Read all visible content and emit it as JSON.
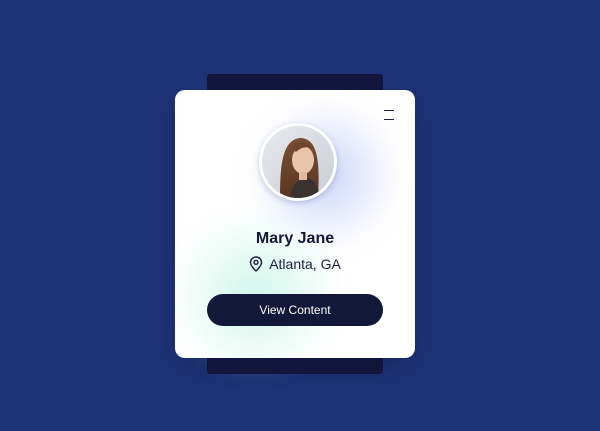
{
  "profile": {
    "name": "Mary Jane",
    "location": "Atlanta, GA",
    "avatar_alt": "Profile photo",
    "cta_label": "View Content"
  },
  "icons": {
    "menu": "menu-icon",
    "location": "map-pin-icon"
  },
  "colors": {
    "background": "#1f3478",
    "card": "#ffffff",
    "back_plate": "#14173d",
    "button": "#141838",
    "button_text": "#ffffff",
    "accent_blue": "#a5b4f5",
    "accent_teal": "#aaf0dc"
  }
}
